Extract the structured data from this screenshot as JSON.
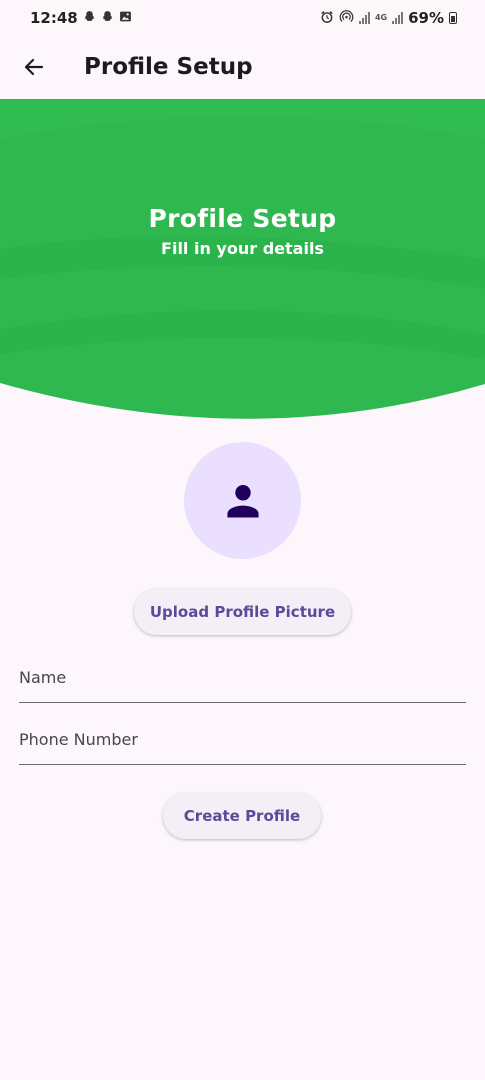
{
  "status_bar": {
    "time": "12:48",
    "battery": "69%",
    "network": "4G",
    "left_icons": [
      "snapchat-icon",
      "snapchat-icon",
      "gallery-icon"
    ],
    "right_icons": [
      "alarm-icon",
      "hotspot-icon",
      "signal-icon",
      "signal-icon",
      "battery-icon"
    ]
  },
  "app_bar": {
    "title": "Profile Setup",
    "back_icon": "arrow-left-icon"
  },
  "header": {
    "title": "Profile Setup",
    "subtitle": "Fill in your details",
    "color": "#2eb84f"
  },
  "avatar": {
    "icon": "person-icon",
    "background": "#eadfff",
    "icon_color": "#21005d"
  },
  "buttons": {
    "upload": "Upload Profile Picture",
    "create": "Create Profile"
  },
  "form": {
    "name_placeholder": "Name",
    "phone_placeholder": "Phone Number"
  }
}
